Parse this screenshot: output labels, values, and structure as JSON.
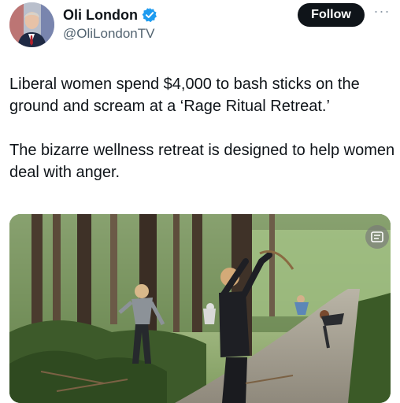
{
  "author": {
    "name": "Oli London",
    "handle": "@OliLondonTV",
    "verified": true,
    "verified_color": "#1d9bf0"
  },
  "actions": {
    "follow_label": "Follow",
    "more_label": "···"
  },
  "tweet": {
    "paragraphs": [
      "Liberal women spend $4,000 to bash sticks on the ground and scream at a ‘Rage Ritual Retreat.’",
      "The bizarre wellness retreat is designed to help women deal with anger."
    ]
  },
  "media": {
    "type": "video",
    "overlay_icon": "media-watermark-icon"
  }
}
